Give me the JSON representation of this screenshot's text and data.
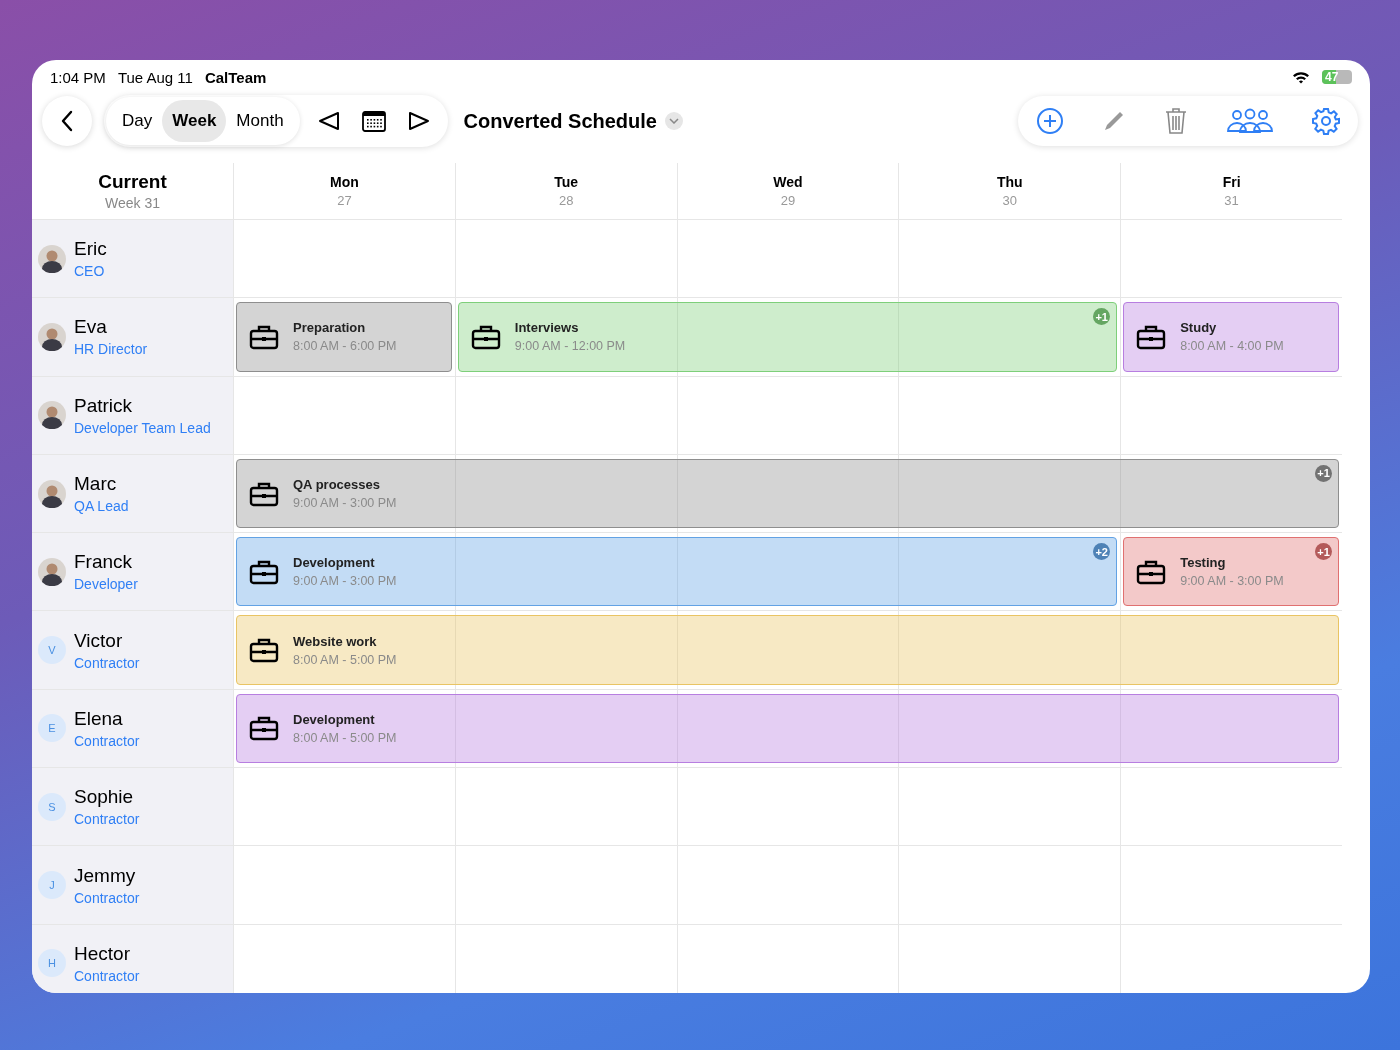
{
  "status_bar": {
    "time": "1:04 PM",
    "date": "Tue Aug 11",
    "app": "CalTeam",
    "battery": {
      "text": "47",
      "level": 0.47
    }
  },
  "toolbar": {
    "views": [
      {
        "label": "Day",
        "selected": false
      },
      {
        "label": "Week",
        "selected": true
      },
      {
        "label": "Month",
        "selected": false
      }
    ],
    "title": "Converted Schedule"
  },
  "header": {
    "title": "Current",
    "subtitle": "Week 31",
    "days": [
      {
        "name": "Mon",
        "date": "27"
      },
      {
        "name": "Tue",
        "date": "28"
      },
      {
        "name": "Wed",
        "date": "29"
      },
      {
        "name": "Thu",
        "date": "30"
      },
      {
        "name": "Fri",
        "date": "31"
      }
    ]
  },
  "people": [
    {
      "name": "Eric",
      "role": "CEO",
      "avatar": {
        "kind": "photo"
      }
    },
    {
      "name": "Eva",
      "role": "HR Director",
      "avatar": {
        "kind": "photo"
      },
      "cells": [
        {
          "kind": "event",
          "title": "Preparation",
          "time": "8:00 AM - 6:00 PM",
          "color": "#8e8e8e"
        },
        {
          "kind": "event",
          "title": "Interviews",
          "time": "9:00 AM - 12:00 PM",
          "color": "#7ecf7a",
          "badge": "+1"
        },
        {
          "kind": "continued"
        },
        {
          "kind": "continued"
        },
        {
          "kind": "event",
          "title": "Study",
          "time": "8:00 AM - 4:00 PM",
          "color": "#b77ee0"
        }
      ]
    },
    {
      "name": "Patrick",
      "role": "Developer Team Lead",
      "avatar": {
        "kind": "photo"
      }
    },
    {
      "name": "Marc",
      "role": "QA Lead",
      "avatar": {
        "kind": "photo"
      },
      "cells": [
        {
          "kind": "event",
          "title": "QA processes",
          "time": "9:00 AM - 3:00 PM",
          "color": "#8e8e8e",
          "badge": "+1"
        },
        {
          "kind": "continued"
        },
        {
          "kind": "continued"
        },
        {
          "kind": "continued"
        },
        {
          "kind": "continued"
        }
      ]
    },
    {
      "name": "Franck",
      "role": "Developer",
      "avatar": {
        "kind": "photo"
      },
      "cells": [
        {
          "kind": "event",
          "title": "Development",
          "time": "9:00 AM - 3:00 PM",
          "color": "#62a2e4",
          "badge": "+2"
        },
        {
          "kind": "continued"
        },
        {
          "kind": "continued"
        },
        {
          "kind": "continued"
        },
        {
          "kind": "event",
          "title": "Testing",
          "time": "9:00 AM - 3:00 PM",
          "color": "#e07070",
          "badge": "+1"
        }
      ]
    },
    {
      "name": "Victor",
      "role": "Contractor",
      "avatar": {
        "kind": "initial",
        "initial": "V"
      },
      "cells": [
        {
          "kind": "event",
          "title": "Website work",
          "time": "8:00 AM - 5:00 PM",
          "color": "#e9c463"
        },
        {
          "kind": "continued"
        },
        {
          "kind": "continued"
        },
        {
          "kind": "continued"
        },
        {
          "kind": "continued"
        }
      ]
    },
    {
      "name": "Elena",
      "role": "Contractor",
      "avatar": {
        "kind": "initial",
        "initial": "E"
      },
      "cells": [
        {
          "kind": "event",
          "title": "Development",
          "time": "8:00 AM - 5:00 PM",
          "color": "#b77ee0"
        },
        {
          "kind": "continued"
        },
        {
          "kind": "continued"
        },
        {
          "kind": "continued"
        },
        {
          "kind": "continued"
        }
      ]
    },
    {
      "name": "Sophie",
      "role": "Contractor",
      "avatar": {
        "kind": "initial",
        "initial": "S"
      }
    },
    {
      "name": "Jemmy",
      "role": "Contractor",
      "avatar": {
        "kind": "initial",
        "initial": "J"
      }
    },
    {
      "name": "Hector",
      "role": "Contractor",
      "avatar": {
        "kind": "initial",
        "initial": "H"
      }
    }
  ]
}
